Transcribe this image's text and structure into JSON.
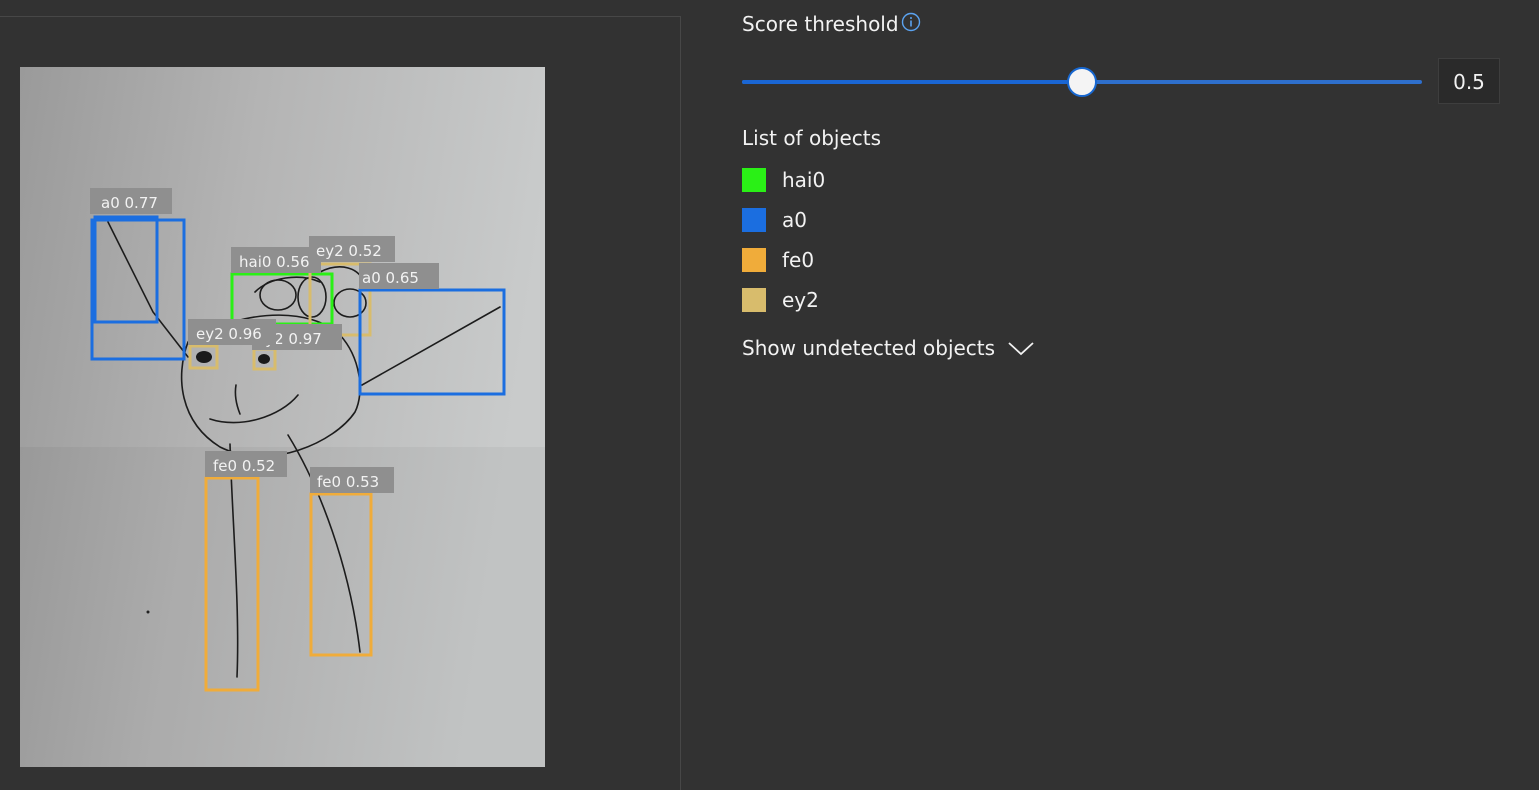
{
  "threshold": {
    "title": "Score threshold",
    "value": "0.5",
    "fraction": 0.5,
    "info_icon": "info-icon"
  },
  "objects_list": {
    "title": "List of objects",
    "items": [
      {
        "label": "hai0",
        "color": "#2af016"
      },
      {
        "label": "a0",
        "color": "#1b6ee0"
      },
      {
        "label": "fe0",
        "color": "#f0ac3a"
      },
      {
        "label": "ey2",
        "color": "#d8bc6c"
      }
    ]
  },
  "show_undetected": {
    "label": "Show undetected objects",
    "icon": "chevron-down-icon"
  },
  "detections": [
    {
      "label": "a0 0.77",
      "class": "a0"
    },
    {
      "label": "hai0 0.56",
      "class": "hai0"
    },
    {
      "label": "ey2 0.52",
      "class": "ey2"
    },
    {
      "label": "a0 0.65",
      "class": "a0"
    },
    {
      "label": "ey2 0.96",
      "class": "ey2"
    },
    {
      "label": "ey2 0.97",
      "class": "ey2"
    },
    {
      "label": "fe0 0.52",
      "class": "fe0"
    },
    {
      "label": "fe0 0.53",
      "class": "fe0"
    }
  ]
}
